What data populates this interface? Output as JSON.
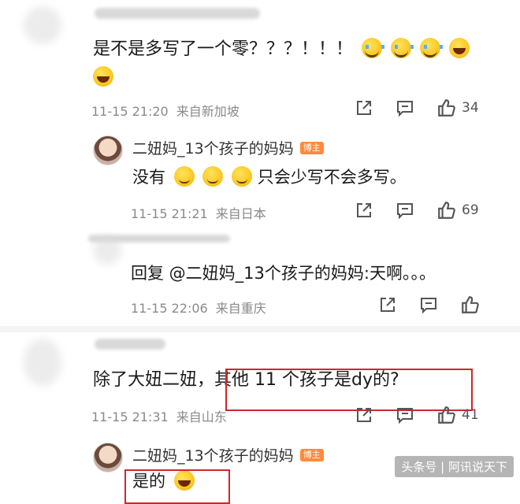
{
  "comments": [
    {
      "text": "是不是多写了一个零？？？！！！",
      "emojis": [
        "cry",
        "cry",
        "cry",
        "laugh",
        "laugh"
      ],
      "time": "11-15 21:20",
      "location": "来自新加坡",
      "likes": "34"
    },
    {
      "username": "二妞妈_13个孩子的妈妈",
      "badge": "博主",
      "text_before": "没有",
      "text_after": "只会少写不会多写。",
      "time": "11-15 21:21",
      "location": "来自日本",
      "likes": "69"
    },
    {
      "text": "回复 @二妞妈_13个孩子的妈妈:天啊。。。",
      "time": "11-15 22:06",
      "location": "来自重庆",
      "likes": ""
    },
    {
      "text_prefix": "除了大妞二妞，",
      "text_highlight": "其他 11 个孩子是dy的?",
      "time": "11-15 21:31",
      "location": "来自山东",
      "likes": "41"
    },
    {
      "username": "二妞妈_13个孩子的妈妈",
      "badge": "博主",
      "text": "是的"
    }
  ],
  "watermark": "头条号 | 阿讯说天下",
  "colors": {
    "highlight_border": "#d2262b",
    "badge_bg": "#ff8a3c"
  },
  "icons": [
    "share-icon",
    "comment-icon",
    "like-icon"
  ]
}
